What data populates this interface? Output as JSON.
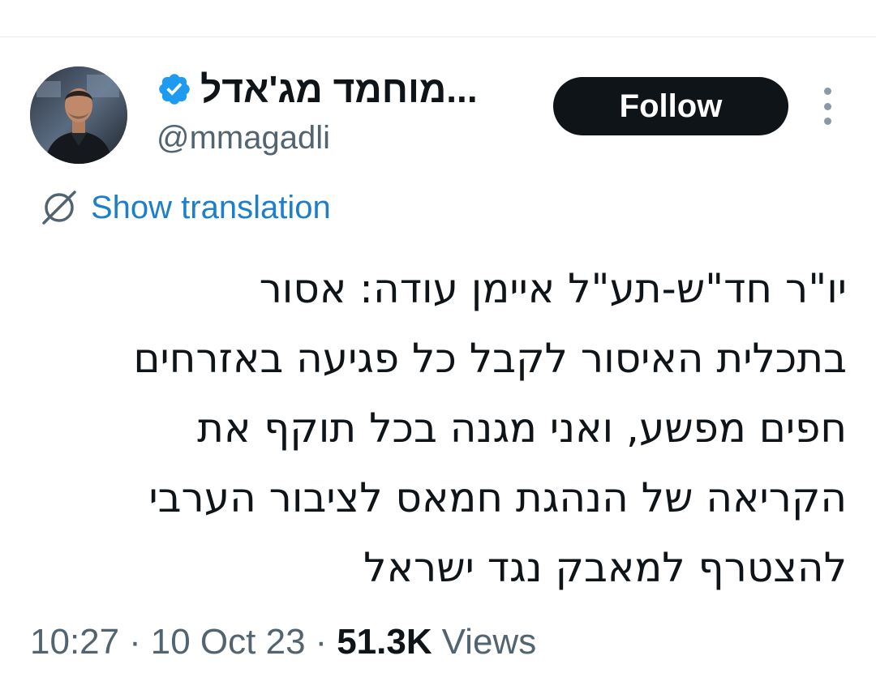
{
  "author": {
    "display_name": "מוחמד מג'אדל...",
    "handle": "@mmagadli",
    "verified": true,
    "avatar_icon": "profile-photo"
  },
  "actions": {
    "follow_label": "Follow",
    "more_icon": "more-vertical-icon"
  },
  "translation": {
    "label": "Show translation",
    "icon": "translate-globe-icon"
  },
  "tweet": {
    "lines": [
      "יו\"ר חד\"ש-תע\"ל איימן עודה: אסור",
      "בתכלית האיסור לקבל כל פגיעה באזרחים",
      "חפים מפשע, ואני מגנה בכל תוקף את",
      "הקריאה של הנהגת חמאס לציבור הערבי",
      "להצטרף למאבק נגד ישראל"
    ]
  },
  "meta": {
    "time": "10:27",
    "separator": "·",
    "date": "10 Oct 23",
    "views_count": "51.3K",
    "views_label": "Views"
  },
  "colors": {
    "text_primary": "#0f1419",
    "text_secondary": "#536471",
    "link_blue": "#1d7fc9",
    "verified_blue": "#1d9bf0",
    "follow_bg": "#0f1419"
  }
}
